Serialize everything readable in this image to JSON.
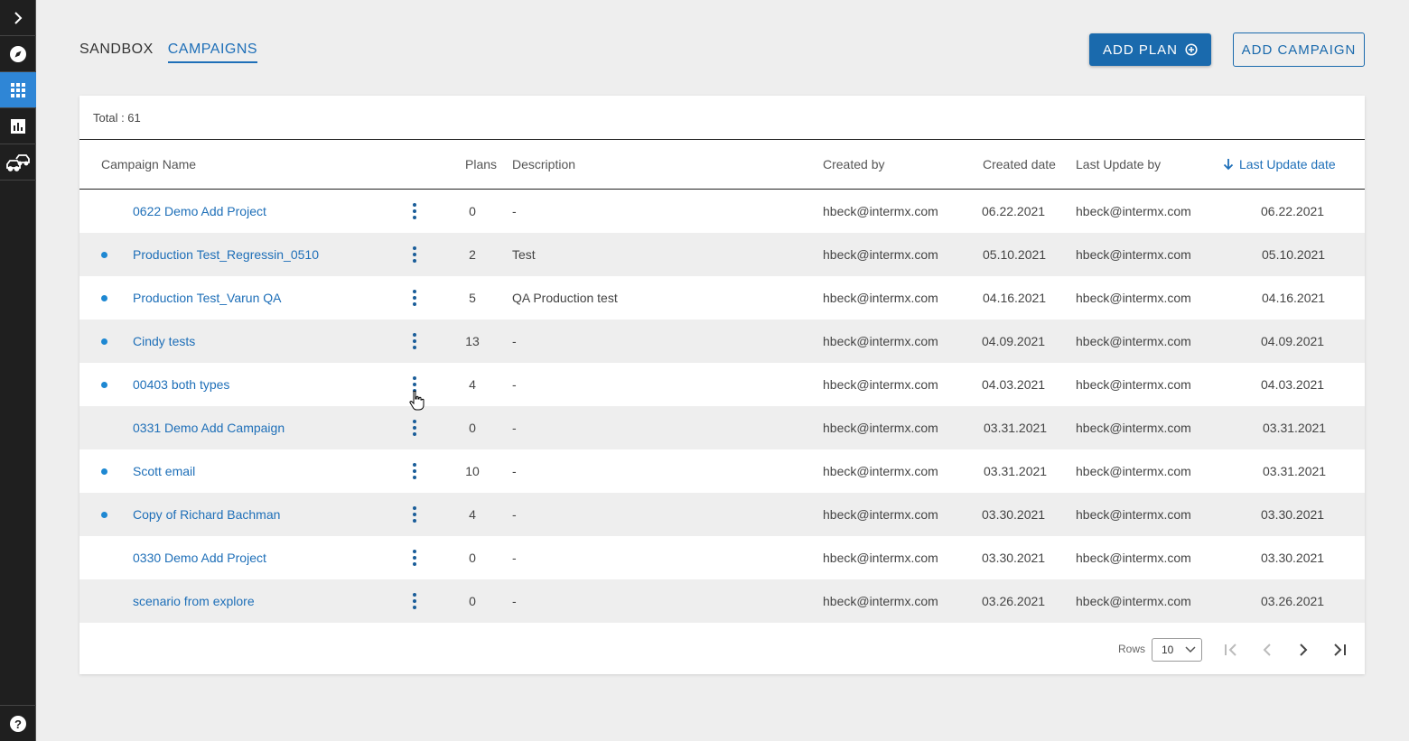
{
  "tabs": [
    {
      "label": "SANDBOX"
    },
    {
      "label": "CAMPAIGNS"
    }
  ],
  "buttons": {
    "add_plan": "ADD PLAN",
    "add_campaign": "ADD CAMPAIGN"
  },
  "table": {
    "total_label": "Total : 61",
    "columns": {
      "campaign_name": "Campaign Name",
      "plans": "Plans",
      "description": "Description",
      "created_by": "Created by",
      "created_date": "Created date",
      "last_update_by": "Last Update by",
      "last_update_date": "Last Update date"
    },
    "sorted_column": "last_update_date",
    "sort_direction": "descending",
    "rows": [
      {
        "name": "0622 Demo Add Project",
        "dot": false,
        "plans": "0",
        "description": "-",
        "created_by": "hbeck@intermx.com",
        "created_date": "06.22.2021",
        "last_update_by": "hbeck@intermx.com",
        "last_update_date": "06.22.2021"
      },
      {
        "name": "Production Test_Regressin_0510",
        "dot": true,
        "plans": "2",
        "description": "Test",
        "created_by": "hbeck@intermx.com",
        "created_date": "05.10.2021",
        "last_update_by": "hbeck@intermx.com",
        "last_update_date": "05.10.2021"
      },
      {
        "name": "Production Test_Varun QA",
        "dot": true,
        "plans": "5",
        "description": "QA Production test",
        "created_by": "hbeck@intermx.com",
        "created_date": "04.16.2021",
        "last_update_by": "hbeck@intermx.com",
        "last_update_date": "04.16.2021"
      },
      {
        "name": "Cindy tests",
        "dot": true,
        "plans": "13",
        "description": "-",
        "created_by": "hbeck@intermx.com",
        "created_date": "04.09.2021",
        "last_update_by": "hbeck@intermx.com",
        "last_update_date": "04.09.2021"
      },
      {
        "name": "00403 both types",
        "dot": true,
        "plans": "4",
        "description": "-",
        "created_by": "hbeck@intermx.com",
        "created_date": "04.03.2021",
        "last_update_by": "hbeck@intermx.com",
        "last_update_date": "04.03.2021"
      },
      {
        "name": "0331 Demo Add Campaign",
        "dot": false,
        "plans": "0",
        "description": "-",
        "created_by": "hbeck@intermx.com",
        "created_date": "03.31.2021",
        "last_update_by": "hbeck@intermx.com",
        "last_update_date": "03.31.2021"
      },
      {
        "name": "Scott email",
        "dot": true,
        "plans": "10",
        "description": "-",
        "created_by": "hbeck@intermx.com",
        "created_date": "03.31.2021",
        "last_update_by": "hbeck@intermx.com",
        "last_update_date": "03.31.2021"
      },
      {
        "name": "Copy of Richard Bachman",
        "dot": true,
        "plans": "4",
        "description": "-",
        "created_by": "hbeck@intermx.com",
        "created_date": "03.30.2021",
        "last_update_by": "hbeck@intermx.com",
        "last_update_date": "03.30.2021"
      },
      {
        "name": "0330 Demo Add Project",
        "dot": false,
        "plans": "0",
        "description": "-",
        "created_by": "hbeck@intermx.com",
        "created_date": "03.30.2021",
        "last_update_by": "hbeck@intermx.com",
        "last_update_date": "03.30.2021"
      },
      {
        "name": "scenario from explore",
        "dot": false,
        "plans": "0",
        "description": "-",
        "created_by": "hbeck@intermx.com",
        "created_date": "03.26.2021",
        "last_update_by": "hbeck@intermx.com",
        "last_update_date": "03.26.2021"
      }
    ]
  },
  "pagination": {
    "rows_label": "Rows",
    "rows_value": "10"
  },
  "sidebar": {
    "items": [
      {
        "icon": "chevron-right-icon"
      },
      {
        "icon": "compass-icon"
      },
      {
        "icon": "grid-icon",
        "active": true
      },
      {
        "icon": "bar-chart-icon"
      },
      {
        "icon": "vehicles-icon"
      }
    ],
    "help_icon": "help-icon"
  },
  "colors": {
    "accent": "#1e6fb8",
    "primary_button": "#1a6aad",
    "sidebar_bg": "#1f1f1f",
    "sidebar_active": "#2f86d6",
    "dot": "#1e88d2"
  }
}
